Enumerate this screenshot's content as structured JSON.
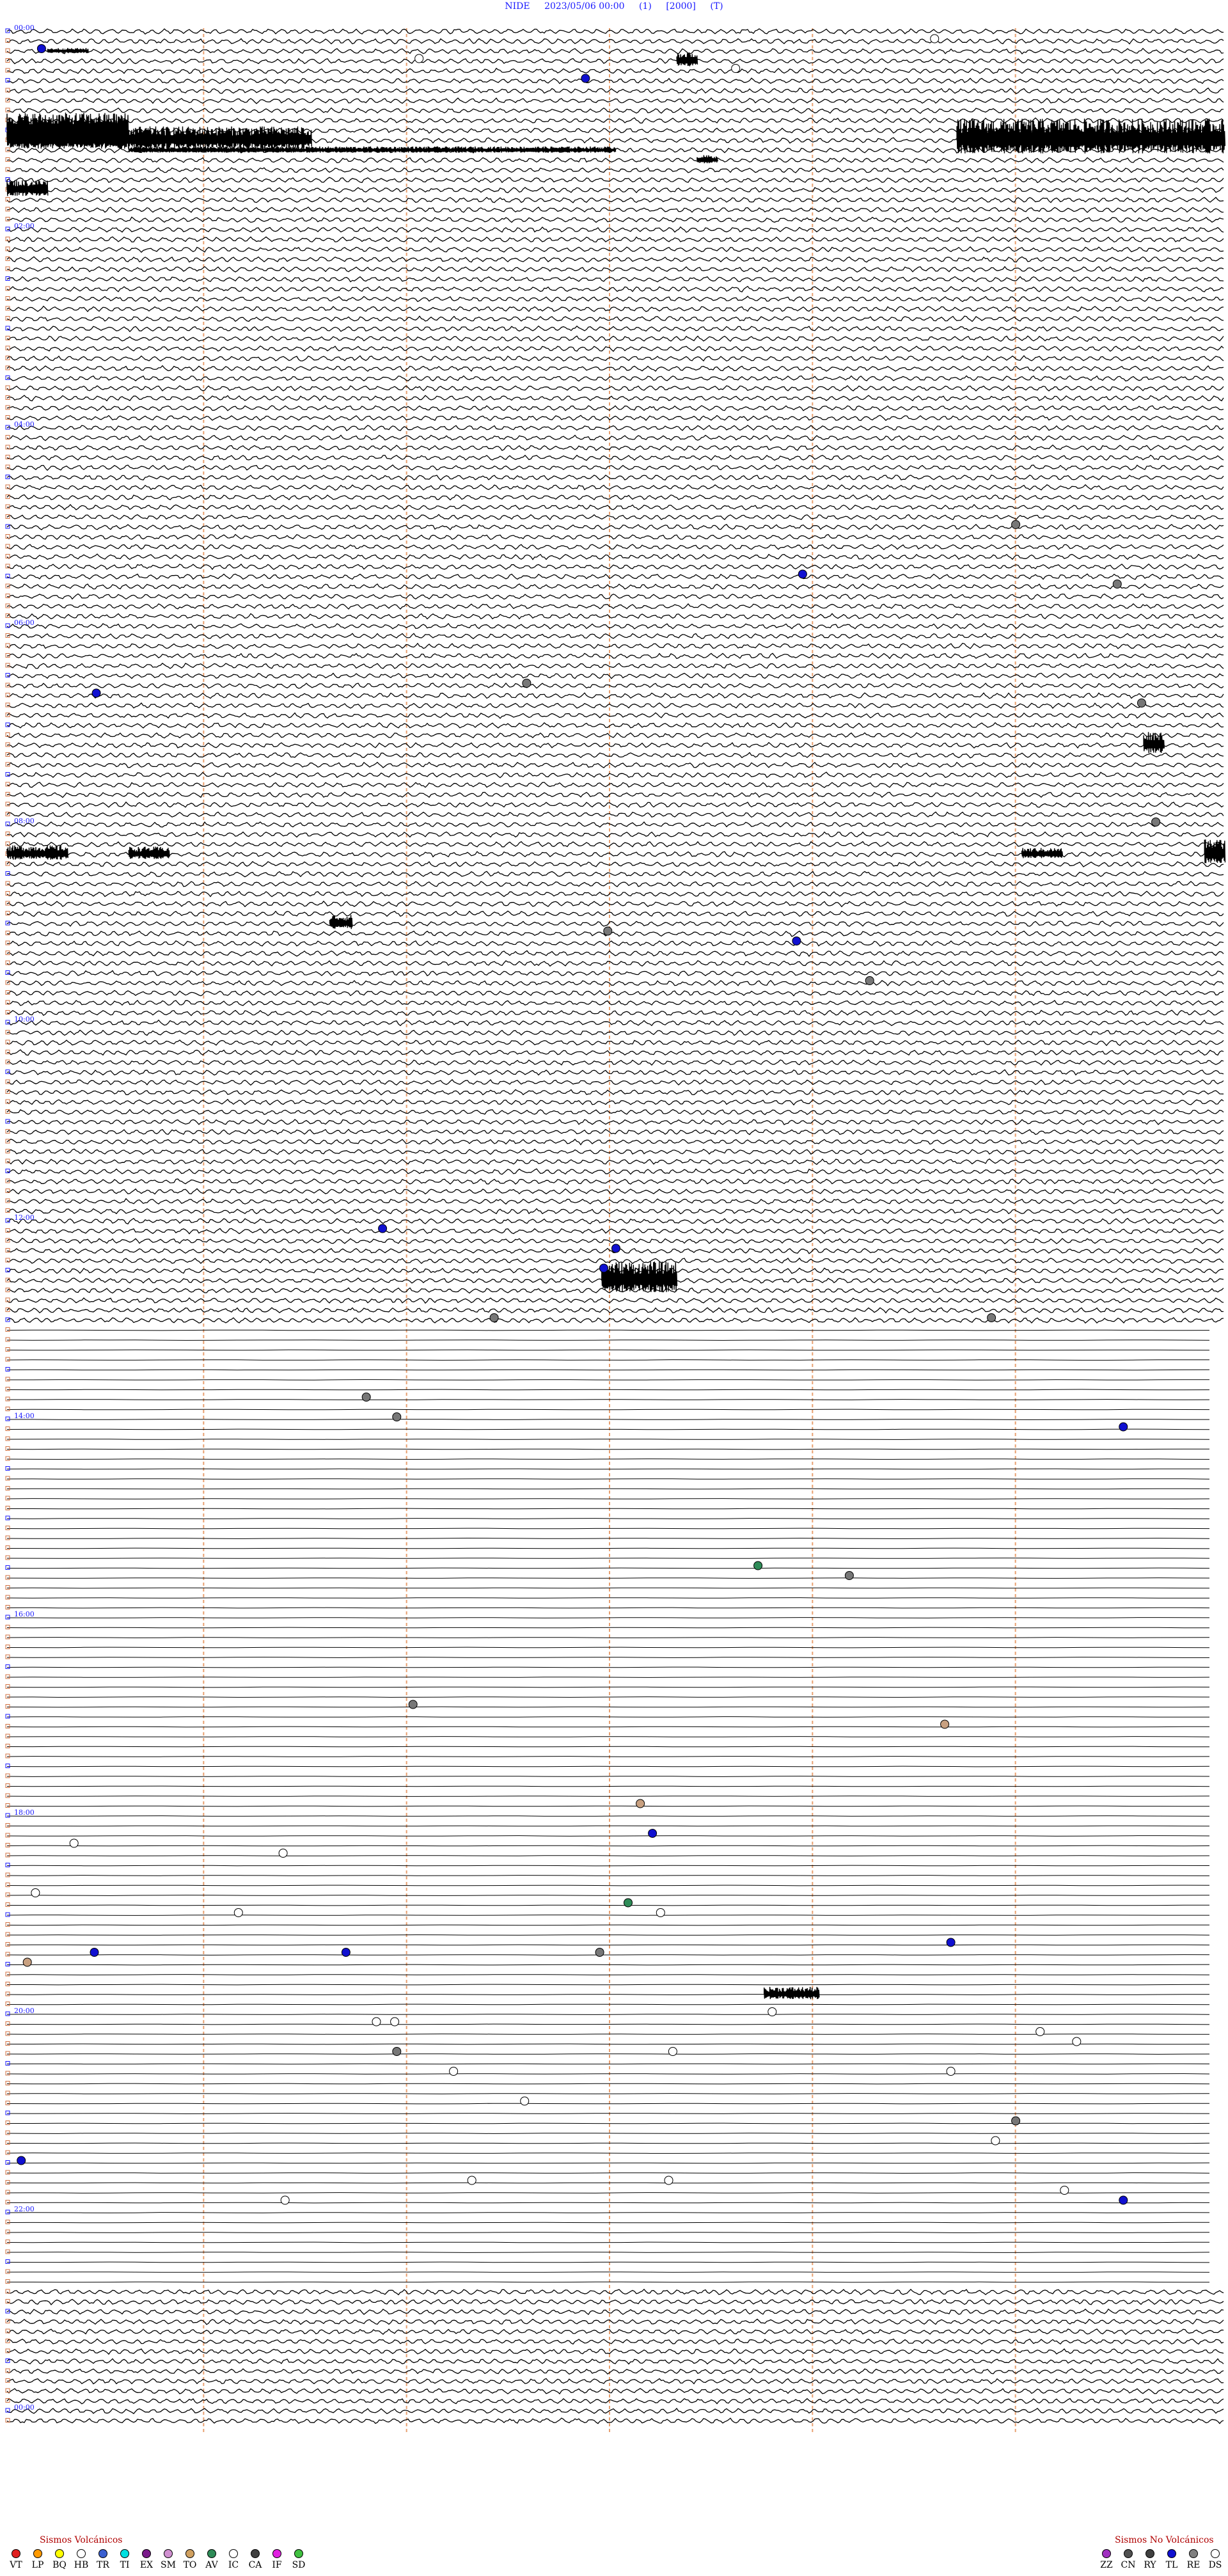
{
  "header": {
    "station": "NIDE",
    "datetime": "2023/05/06 00:00",
    "p1": "(1)",
    "p2": "[2000]",
    "p3": "(T)"
  },
  "chart_data": {
    "type": "helicorder",
    "station": "NIDE",
    "date": "2023/05/06",
    "hour_labels": [
      "00:00",
      "02:00",
      "04:00",
      "06:00",
      "08:00",
      "10:00",
      "12:00",
      "14:00",
      "16:00",
      "18:00",
      "20:00",
      "22:00",
      "00:00"
    ],
    "rows_per_hour": 10,
    "total_rows": 242,
    "minute_marker_count": 5,
    "quiet_rows": [
      131,
      228
    ],
    "events": [
      {
        "row": 1,
        "min": 45.7,
        "color": "#ffffff"
      },
      {
        "row": 2,
        "min": 1.7,
        "color": "#1010d0"
      },
      {
        "row": 3,
        "min": 20.3,
        "color": "#ffffff"
      },
      {
        "row": 4,
        "min": 35.9,
        "color": "#ffffff"
      },
      {
        "row": 5,
        "min": 28.5,
        "color": "#1010d0"
      },
      {
        "row": 50,
        "min": 49.7,
        "color": "#777777"
      },
      {
        "row": 55,
        "min": 39.2,
        "color": "#1010d0"
      },
      {
        "row": 56,
        "min": 54.7,
        "color": "#777777"
      },
      {
        "row": 66,
        "min": 25.6,
        "color": "#777777"
      },
      {
        "row": 67,
        "min": 4.4,
        "color": "#1010d0"
      },
      {
        "row": 68,
        "min": 55.9,
        "color": "#777777"
      },
      {
        "row": 80,
        "min": 56.6,
        "color": "#777777"
      },
      {
        "row": 91,
        "min": 29.6,
        "color": "#777777"
      },
      {
        "row": 92,
        "min": 38.9,
        "color": "#1010d0"
      },
      {
        "row": 96,
        "min": 42.5,
        "color": "#777777"
      },
      {
        "row": 121,
        "min": 18.5,
        "color": "#1010d0"
      },
      {
        "row": 123,
        "min": 30.0,
        "color": "#1010d0"
      },
      {
        "row": 125,
        "min": 29.4,
        "color": "#1010d0"
      },
      {
        "row": 130,
        "min": 24.0,
        "color": "#777777"
      },
      {
        "row": 130,
        "min": 48.5,
        "color": "#777777"
      },
      {
        "row": 138,
        "min": 17.7,
        "color": "#777777"
      },
      {
        "row": 140,
        "min": 19.2,
        "color": "#777777"
      },
      {
        "row": 141,
        "min": 55.0,
        "color": "#1010d0"
      },
      {
        "row": 155,
        "min": 37.0,
        "color": "#2e8b57"
      },
      {
        "row": 156,
        "min": 41.5,
        "color": "#777777"
      },
      {
        "row": 169,
        "min": 20.0,
        "color": "#777777"
      },
      {
        "row": 171,
        "min": 46.2,
        "color": "#c8a080"
      },
      {
        "row": 179,
        "min": 31.2,
        "color": "#c8a080"
      },
      {
        "row": 182,
        "min": 31.8,
        "color": "#1010d0"
      },
      {
        "row": 183,
        "min": 3.3,
        "color": "#ffffff"
      },
      {
        "row": 184,
        "min": 13.6,
        "color": "#ffffff"
      },
      {
        "row": 188,
        "min": 1.4,
        "color": "#ffffff"
      },
      {
        "row": 189,
        "min": 30.6,
        "color": "#2e8b57"
      },
      {
        "row": 190,
        "min": 32.2,
        "color": "#ffffff"
      },
      {
        "row": 190,
        "min": 11.4,
        "color": "#ffffff"
      },
      {
        "row": 193,
        "min": 46.5,
        "color": "#1010d0"
      },
      {
        "row": 194,
        "min": 4.3,
        "color": "#1010d0"
      },
      {
        "row": 194,
        "min": 16.7,
        "color": "#1010d0"
      },
      {
        "row": 194,
        "min": 29.2,
        "color": "#777777"
      },
      {
        "row": 195,
        "min": 1.0,
        "color": "#c8a080"
      },
      {
        "row": 200,
        "min": 37.7,
        "color": "#ffffff"
      },
      {
        "row": 201,
        "min": 18.2,
        "color": "#ffffff"
      },
      {
        "row": 201,
        "min": 19.1,
        "color": "#ffffff"
      },
      {
        "row": 202,
        "min": 50.9,
        "color": "#ffffff"
      },
      {
        "row": 203,
        "min": 52.7,
        "color": "#ffffff"
      },
      {
        "row": 204,
        "min": 19.2,
        "color": "#777777"
      },
      {
        "row": 204,
        "min": 32.8,
        "color": "#ffffff"
      },
      {
        "row": 206,
        "min": 22.0,
        "color": "#ffffff"
      },
      {
        "row": 206,
        "min": 46.5,
        "color": "#ffffff"
      },
      {
        "row": 209,
        "min": 25.5,
        "color": "#ffffff"
      },
      {
        "row": 211,
        "min": 49.7,
        "color": "#777777"
      },
      {
        "row": 213,
        "min": 48.7,
        "color": "#ffffff"
      },
      {
        "row": 215,
        "min": 0.7,
        "color": "#1010d0"
      },
      {
        "row": 217,
        "min": 22.9,
        "color": "#ffffff"
      },
      {
        "row": 217,
        "min": 32.6,
        "color": "#ffffff"
      },
      {
        "row": 218,
        "min": 52.1,
        "color": "#ffffff"
      },
      {
        "row": 219,
        "min": 55.0,
        "color": "#1010d0"
      },
      {
        "row": 219,
        "min": 13.7,
        "color": "#ffffff"
      }
    ],
    "bursts": [
      {
        "row": 2,
        "start": 2.0,
        "end": 4.0,
        "amp": 5
      },
      {
        "row": 3,
        "start": 33.0,
        "end": 34.0,
        "amp": 14
      },
      {
        "row": 10,
        "start": 0.0,
        "end": 6.0,
        "amp": 28
      },
      {
        "row": 11,
        "start": 0.0,
        "end": 15.0,
        "amp": 22
      },
      {
        "row": 11,
        "start": 46.8,
        "end": 60.0,
        "amp": 34
      },
      {
        "row": 12,
        "start": 6.0,
        "end": 30.0,
        "amp": 6
      },
      {
        "row": 13,
        "start": 34.0,
        "end": 35.0,
        "amp": 8
      },
      {
        "row": 16,
        "start": 0.0,
        "end": 2.0,
        "amp": 16
      },
      {
        "row": 72,
        "start": 56.0,
        "end": 57.0,
        "amp": 22
      },
      {
        "row": 83,
        "start": 0.0,
        "end": 3.0,
        "amp": 14
      },
      {
        "row": 83,
        "start": 6.0,
        "end": 8.0,
        "amp": 12
      },
      {
        "row": 83,
        "start": 50.0,
        "end": 52.0,
        "amp": 10
      },
      {
        "row": 83,
        "start": 59.0,
        "end": 60.0,
        "amp": 24
      },
      {
        "row": 90,
        "start": 15.9,
        "end": 17.0,
        "amp": 14
      },
      {
        "row": 126,
        "start": 29.3,
        "end": 33.0,
        "amp": 30
      },
      {
        "row": 198,
        "start": 37.3,
        "end": 40.0,
        "amp": 12
      }
    ]
  },
  "legend_left": {
    "title": "Sismos Volcánicos",
    "items": [
      {
        "code": "VT",
        "color": "#e02020"
      },
      {
        "code": "LP",
        "color": "#ff9a00"
      },
      {
        "code": "BQ",
        "color": "#ffff00"
      },
      {
        "code": "HB",
        "color": "#ffffff"
      },
      {
        "code": "TR",
        "color": "#3a5fd0"
      },
      {
        "code": "TI",
        "color": "#00e0e0"
      },
      {
        "code": "EX",
        "color": "#7a1a8a"
      },
      {
        "code": "SM",
        "color": "#d090d0"
      },
      {
        "code": "TO",
        "color": "#d0a060"
      },
      {
        "code": "AV",
        "color": "#2e8b57"
      },
      {
        "code": "IC",
        "color": "#ffffff"
      },
      {
        "code": "CA",
        "color": "#404040"
      },
      {
        "code": "IF",
        "color": "#e020e0"
      },
      {
        "code": "SD",
        "color": "#40c040"
      }
    ]
  },
  "legend_right": {
    "title": "Sismos No Volcánicos",
    "items": [
      {
        "code": "ZZ",
        "color": "#a030c0"
      },
      {
        "code": "CN",
        "color": "#505050"
      },
      {
        "code": "RY",
        "color": "#404040"
      },
      {
        "code": "TL",
        "color": "#1010d0"
      },
      {
        "code": "RE",
        "color": "#808080"
      },
      {
        "code": "DS",
        "color": "#ffffff"
      }
    ]
  }
}
